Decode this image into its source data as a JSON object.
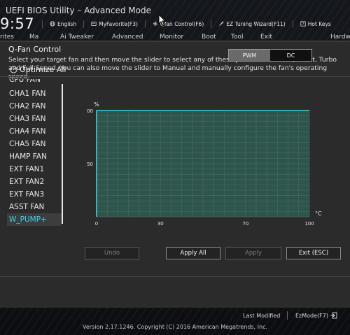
{
  "window": {
    "title": "UEFI BIOS Utility – Advanced Mode",
    "clock": "9:57"
  },
  "topbar": {
    "items": [
      {
        "label": "English",
        "icon": "globe-icon"
      },
      {
        "label": "MyFavorite(F3)",
        "icon": "favorite-icon"
      },
      {
        "label": "Qfan Control(F6)",
        "icon": "fan-icon"
      },
      {
        "label": "EZ Tuning Wizard(F11)",
        "icon": "wand-icon"
      },
      {
        "label": "Hot Keys",
        "icon": "question-icon"
      }
    ]
  },
  "menubar": {
    "tabs": [
      "rites",
      "Ma",
      "Ai Tweaker",
      "Advanced",
      "Monitor",
      "Boot",
      "Tool",
      "Exit",
      "Hardw"
    ]
  },
  "panel": {
    "title": "Q-Fan Control",
    "description": "Select your target fan and then move the slider to select any of these profiles: Standard, Silent, Turbo and Full Speed. You can also move the slider to Manual and manually configure the fan's operating speed."
  },
  "mode_toggle": {
    "options": [
      "PWM",
      "DC"
    ],
    "selected": "PWM"
  },
  "optimize_label": "Optimize All",
  "fan_list": {
    "items": [
      "CPU FAN",
      "CHA1 FAN",
      "CHA2 FAN",
      "CHA3 FAN",
      "CHA4 FAN",
      "CHA5 FAN",
      "HAMP FAN",
      "EXT FAN1",
      "EXT FAN2",
      "EXT FAN3",
      "ASST FAN",
      "W_PUMP+"
    ],
    "selected": "W_PUMP+"
  },
  "chart_data": {
    "type": "area",
    "xlabel": "°C",
    "ylabel": "%",
    "xlim": [
      0,
      100
    ],
    "ylim": [
      0,
      100
    ],
    "x_ticks": [
      0,
      30,
      70,
      100
    ],
    "y_ticks": [
      50,
      100
    ],
    "grid": true,
    "series": [
      {
        "x": [
          0,
          0,
          100
        ],
        "y": [
          0,
          100,
          100
        ]
      }
    ],
    "colors": {
      "line": "#35d1de",
      "fill": "#2d5b50",
      "grid": "#5e7d74"
    }
  },
  "buttons": {
    "undo": "Undo",
    "apply_all": "Apply All",
    "apply": "Apply",
    "exit": "Exit (ESC)"
  },
  "statusbar": {
    "last_modified": "Last Modified",
    "ezmode": "EzMode(F7)"
  },
  "version": "Version 2.17.1246. Copyright (C) 2016 American Megatrends, Inc."
}
